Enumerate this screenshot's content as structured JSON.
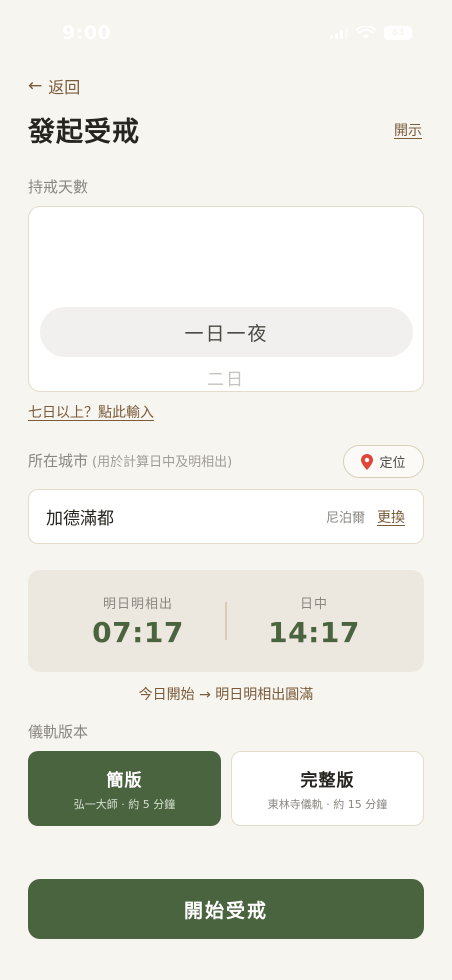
{
  "status_bar": {
    "time": "9:00",
    "battery": "83"
  },
  "nav": {
    "back_label": "返回"
  },
  "header": {
    "title": "發起受戒",
    "help_label": "開示"
  },
  "duration": {
    "label": "持戒天數",
    "selected": "一日一夜",
    "next": "二日",
    "more_link": "七日以上？點此輸入"
  },
  "city": {
    "label": "所在城市",
    "sublabel": "(用於計算日中及明相出)",
    "locate_label": "定位",
    "name": "加德滿都",
    "country": "尼泊爾",
    "change_label": "更換"
  },
  "times": {
    "dawn_label": "明日明相出",
    "dawn_value": "07:17",
    "noon_label": "日中",
    "noon_value": "14:17",
    "period_note": "今日開始 → 明日明相出圓滿"
  },
  "ritual": {
    "label": "儀軌版本",
    "options": [
      {
        "name": "簡版",
        "desc": "弘一大師 · 約 5 分鐘",
        "selected": true
      },
      {
        "name": "完整版",
        "desc": "東林寺儀軌 · 約 15 分鐘",
        "selected": false
      }
    ]
  },
  "actions": {
    "start_label": "開始受戒"
  },
  "colors": {
    "accent_green": "#4b6440",
    "link_brown": "#7a5b3a",
    "background": "#f7f5f0",
    "card_beige": "#ede8df"
  },
  "icons": {
    "back": "arrow-left-icon",
    "locate": "map-pin-icon"
  }
}
